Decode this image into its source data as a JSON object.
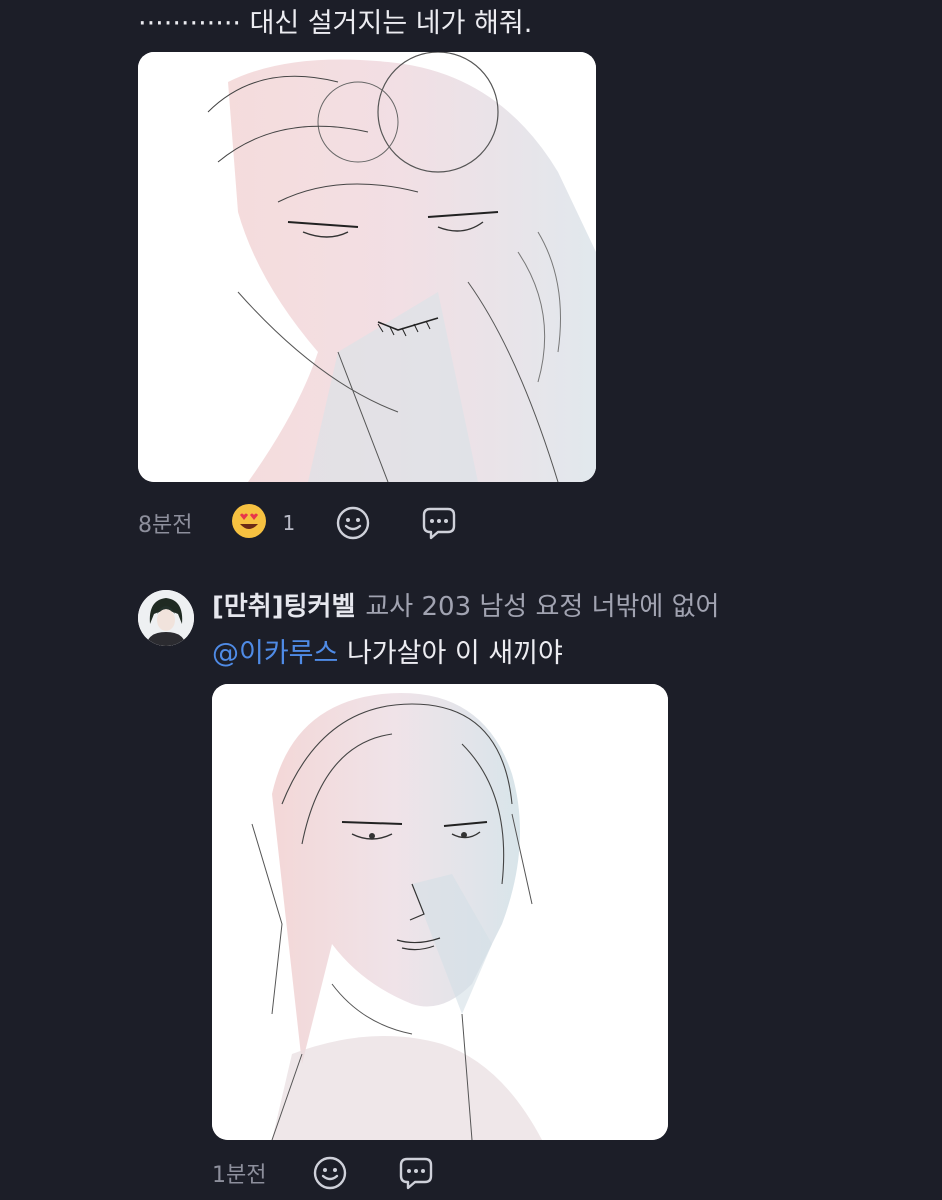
{
  "comments": [
    {
      "text": "············ 대신 설거지는 네가 해줘.",
      "time": "8분전",
      "reaction": {
        "icon": "heart-eyes-emoji",
        "count": "1"
      },
      "image": {
        "alt_icon": "sketch-illustration"
      }
    },
    {
      "username": "[만취]팅커벨",
      "status": "교사 203 남성 요정 너밖에 없어",
      "mention": "@이카루스",
      "text": " 나가살아 이 새끼야",
      "time": "1분전",
      "image": {
        "alt_icon": "sketch-illustration"
      }
    }
  ],
  "icons": {
    "reaction_button": "smile-icon",
    "reply_button": "chat-bubble-icon"
  },
  "colors": {
    "background": "#1c1e28",
    "mention": "#4f8be6",
    "meta_text": "#8d8f9c"
  }
}
